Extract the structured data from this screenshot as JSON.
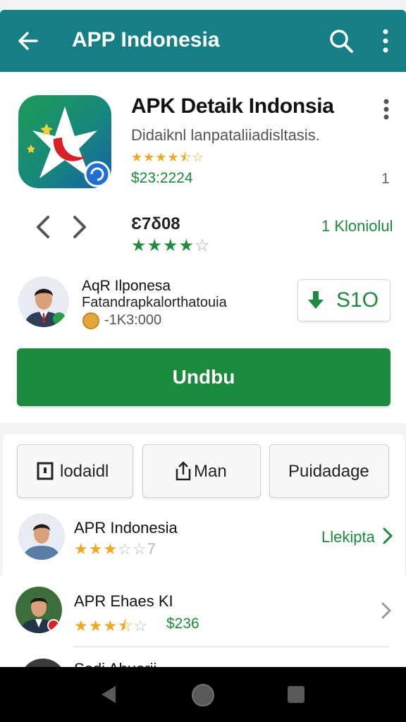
{
  "colors": {
    "appbar": "#167f86",
    "primary": "#1b8a3c",
    "star": "#f1a81e"
  },
  "appbar": {
    "title": "APP Indonesia",
    "back_icon": "arrow-left-icon",
    "search_icon": "search-icon",
    "more_icon": "more-vert-icon"
  },
  "app": {
    "name": "APK Detaik Indonsia",
    "subtitle": "Didaiknl lanpataliiadisltasis.",
    "rating_stars": "★★★★⯪☆",
    "price": "$23:2224",
    "side_number": "1",
    "count": "Ɛ7δ08",
    "green_stars_filled": "★★★★",
    "green_stars_empty": "☆",
    "link": "1 Kloniolul"
  },
  "developer": {
    "name": "AqR Ilponesa",
    "description": "Fatandrapkalorthatouia",
    "coins": "-1K3:000"
  },
  "price_button": {
    "label": "S1O"
  },
  "install_button": {
    "label": "Undbu"
  },
  "tabs": [
    {
      "label": "lodaidl",
      "icon": "square-icon"
    },
    {
      "label": "Man",
      "icon": "share-icon"
    },
    {
      "label": "Puidadage"
    }
  ],
  "list": [
    {
      "title": "APR Indonesia",
      "stars_filled": "★★★",
      "stars_empty": "☆☆7",
      "link": "Llekipta"
    },
    {
      "title": "APR Ehaes KI",
      "stars_filled": "★★★⯪",
      "stars_empty": "☆",
      "price": "$236"
    },
    {
      "title": "Sodi Ahuorii"
    }
  ]
}
